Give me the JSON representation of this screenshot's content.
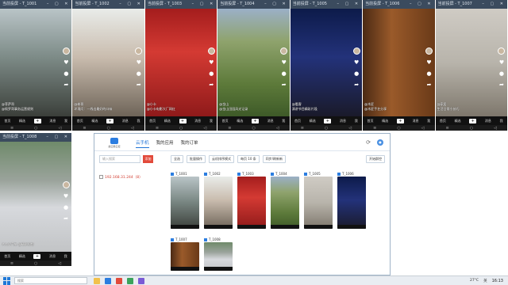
{
  "phones_top": [
    {
      "title": "当前投屏 - T_1001",
      "caption_user": "@菲萨哥",
      "caption": "@佩罗哥事务运营规则",
      "scene": "s1"
    },
    {
      "title": "当前投屏 - T_1002",
      "caption_user": "@卷哥",
      "caption": "环境问：一线出最好的口味",
      "scene": "s2"
    },
    {
      "title": "当前投屏 - T_1003",
      "caption_user": "@小卡",
      "caption": "@小卡电影大厂网红",
      "scene": "s3"
    },
    {
      "title": "当前投屏 - T_1004",
      "caption_user": "@金山",
      "caption": "@金山田园风光记录",
      "scene": "s4"
    },
    {
      "title": "当前投屏 - T_1005",
      "caption_user": "@看客",
      "caption": "演讲节目精彩片段",
      "scene": "s5"
    },
    {
      "title": "当前投屏 - T_1006",
      "caption_user": "@木匠",
      "caption": "@木匠手艺分享",
      "scene": "s6"
    },
    {
      "title": "当前投屏 - T_1007",
      "caption_user": "@家居",
      "caption": "生活日常小技巧",
      "scene": "s7"
    }
  ],
  "phone_left": {
    "title": "当前投屏 - T_1008",
    "caption": "#大众汽车 @精彩视频",
    "scene": "s8"
  },
  "phone_nav": {
    "home": "首页",
    "featured": "精选",
    "plus": "+",
    "inbox": "消息",
    "me": "我"
  },
  "manager": {
    "logo_text": "魔云腾云控",
    "tabs": [
      "云手机",
      "我的应用",
      "我的订单"
    ],
    "active_tab": 0,
    "toolbar": [
      "全选",
      "批量操作",
      "云机排序模式",
      "每页 10 条",
      "同步/刷新新"
    ],
    "toolbar_right": "开始群控",
    "search_placeholder": "输入搜索",
    "add_button": "添加",
    "ip_entry": "192.168.31.244（8）",
    "devices": [
      {
        "id": "T_1001",
        "scene": "s1"
      },
      {
        "id": "T_1002",
        "scene": "s2"
      },
      {
        "id": "T_1003",
        "scene": "s3"
      },
      {
        "id": "T_1004",
        "scene": "s4"
      },
      {
        "id": "T_1005",
        "scene": "s7"
      },
      {
        "id": "T_1006",
        "scene": "s5"
      },
      {
        "id": "T_1007",
        "scene": "s6"
      },
      {
        "id": "T_1008",
        "scene": "s8"
      }
    ]
  },
  "taskbar": {
    "search_placeholder": "搜索",
    "temperature": "27°C",
    "language": "英",
    "time": "16:13"
  }
}
